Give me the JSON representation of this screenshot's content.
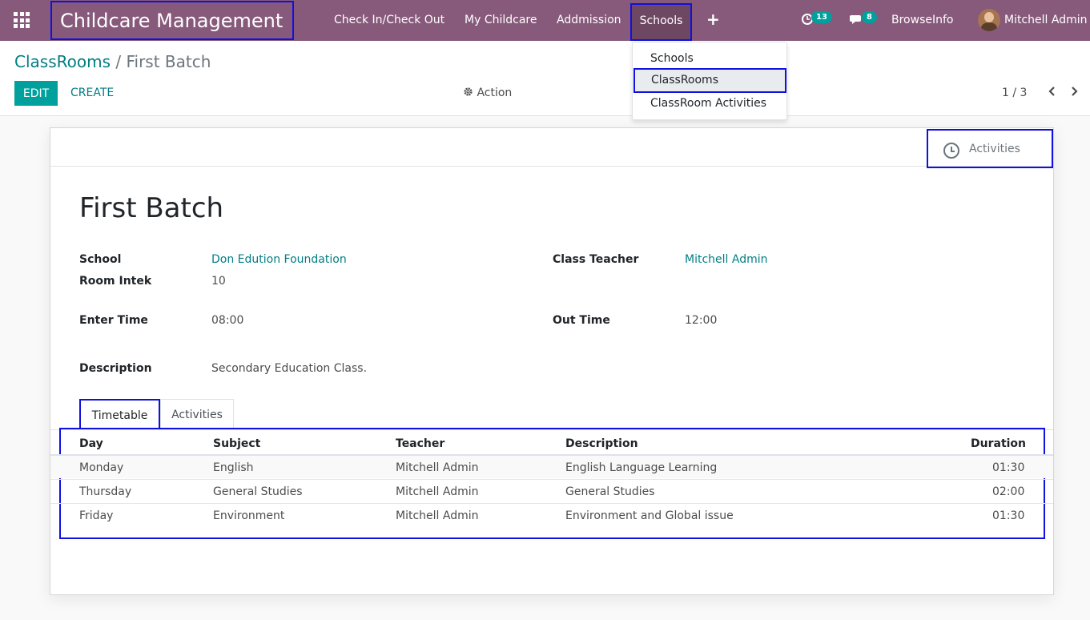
{
  "navbar": {
    "app_title": "Childcare Management",
    "menu": [
      "Check In/Check Out",
      "My Childcare",
      "Addmission",
      "Schools"
    ],
    "plus": "+",
    "activity_count": "13",
    "message_count": "8",
    "company": "BrowseInfo",
    "user": "Mitchell Admin"
  },
  "dropdown": {
    "items": [
      "Schools",
      "ClassRooms",
      "ClassRoom Activities"
    ],
    "active_index": 1
  },
  "control_panel": {
    "breadcrumb_parent": "ClassRooms",
    "breadcrumb_sep": "/",
    "breadcrumb_current": "First Batch",
    "edit": "EDIT",
    "create": "CREATE",
    "action": "Action",
    "pager": "1 / 3"
  },
  "sheet": {
    "activities_button": "Activities",
    "title": "First Batch",
    "fields": {
      "school_label": "School",
      "school_value": "Don Edution Foundation",
      "class_teacher_label": "Class Teacher",
      "class_teacher_value": "Mitchell Admin",
      "room_intek_label": "Room Intek",
      "room_intek_value": "10",
      "enter_time_label": "Enter Time",
      "enter_time_value": "08:00",
      "out_time_label": "Out Time",
      "out_time_value": "12:00",
      "description_label": "Description",
      "description_value": "Secondary Education Class."
    },
    "tabs": [
      "Timetable",
      "Activities"
    ],
    "active_tab": 0,
    "table": {
      "headers": [
        "Day",
        "Subject",
        "Teacher",
        "Description",
        "Duration"
      ],
      "rows": [
        [
          "Monday",
          "English",
          "Mitchell Admin",
          "English Language Learning",
          "01:30"
        ],
        [
          "Thursday",
          "General Studies",
          "Mitchell Admin",
          "General Studies",
          "02:00"
        ],
        [
          "Friday",
          "Environment",
          "Mitchell Admin",
          "Environment and Global issue",
          "01:30"
        ]
      ]
    }
  },
  "colors": {
    "navbar": "#875a7b",
    "accent": "#00a09d",
    "link": "#017e84",
    "highlight_border": "#1010e0"
  }
}
